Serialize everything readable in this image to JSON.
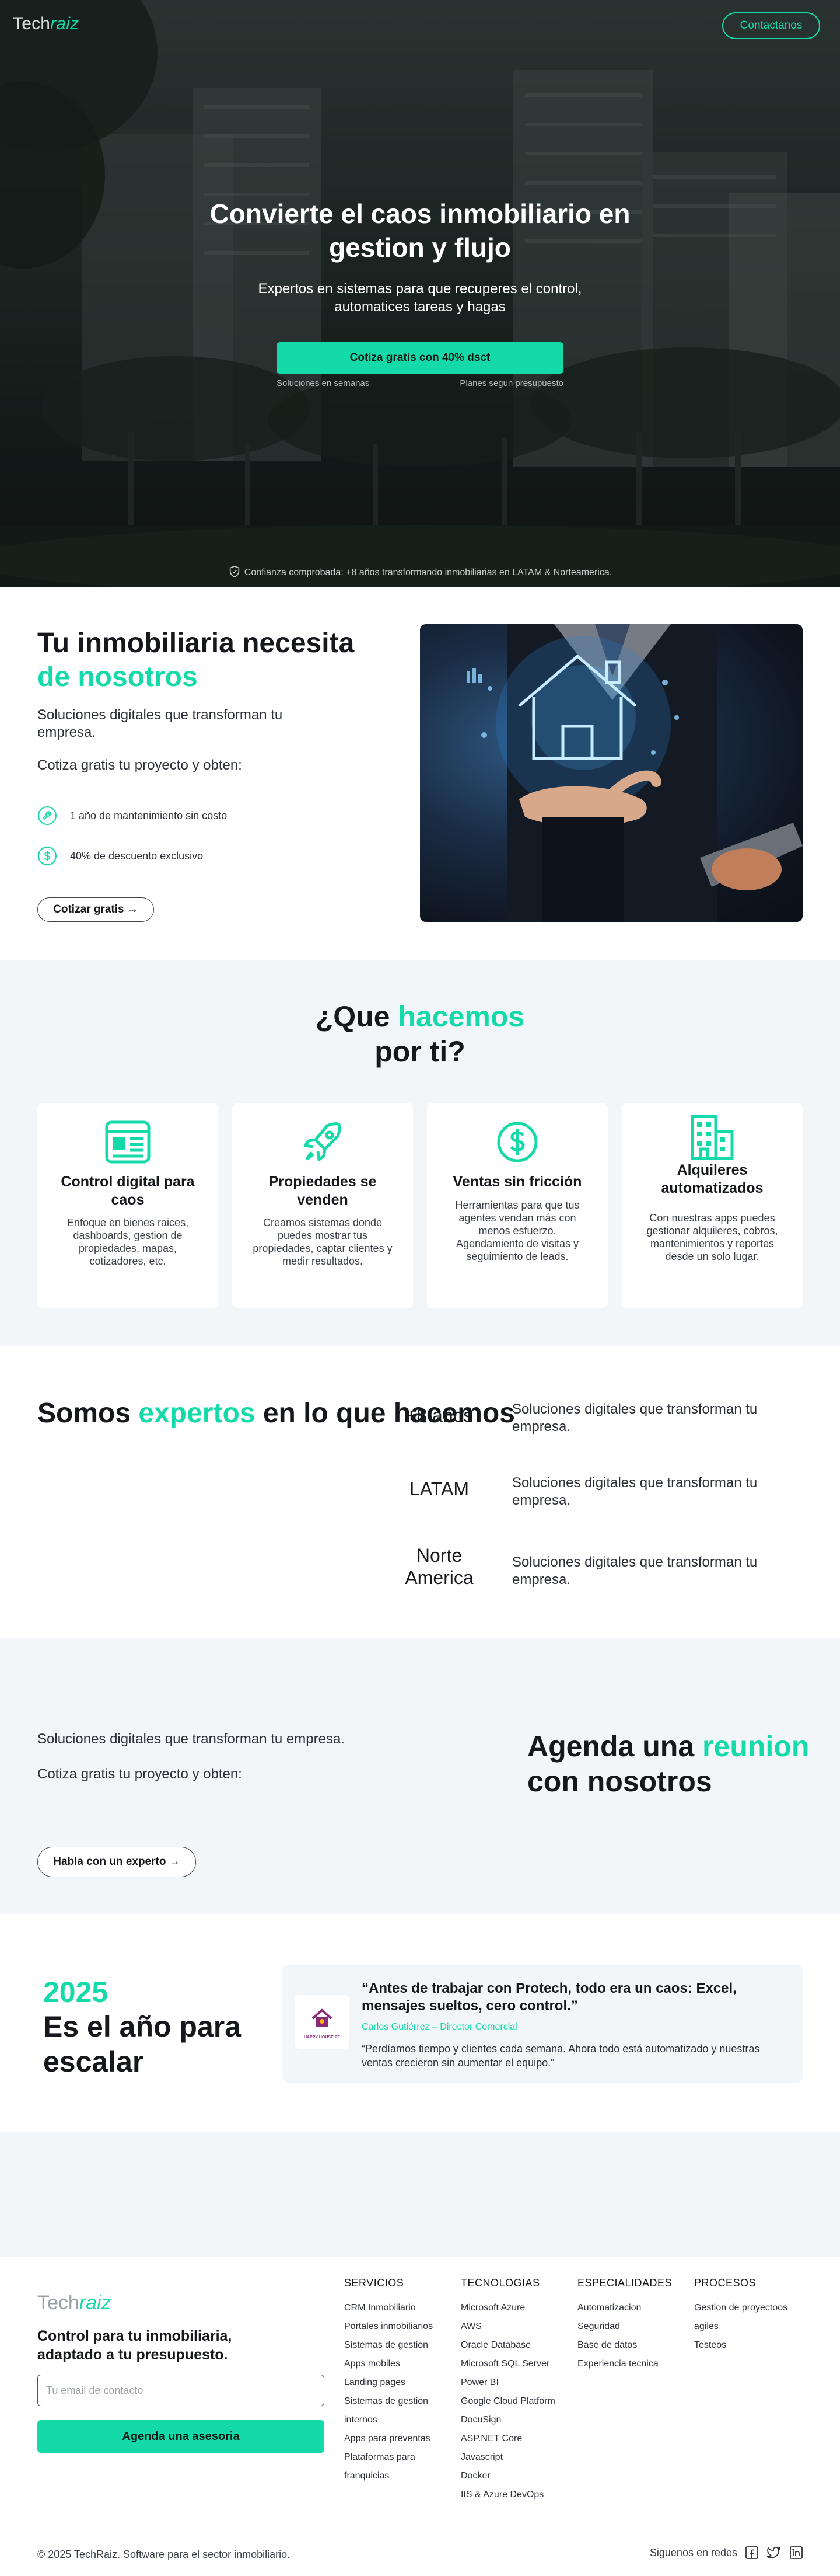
{
  "colors": {
    "accent": "#14d9a8",
    "dark_text": "#16181d",
    "light_section": "#f2f6f9"
  },
  "hero": {
    "logo_main": "Tech",
    "logo_accent": "raiz",
    "contact_button": "Contactanos",
    "title": "Convierte el caos inmobiliario en gestion y flujo",
    "subtitle": "Expertos en sistemas para que recuperes el control, automatices tareas y hagas",
    "cta": "Cotiza gratis con 40% dsct",
    "note_left": "Soluciones en semanas",
    "note_right": "Planes segun presupuesto",
    "trust": "Confianza comprobada: +8 años transformando inmobiliarias en LATAM & Norteamerica.",
    "trust_icon": "shield-check-icon"
  },
  "intro": {
    "title_main": "Tu inmobiliaria necesita",
    "title_accent": "de nosotros",
    "p1": "Soluciones digitales que transforman tu empresa.",
    "p2": "Cotiza gratis tu proyecto y obten:",
    "benefits": [
      {
        "icon": "wrench-icon",
        "text": "1 año de mantenimiento sin costo"
      },
      {
        "icon": "dollar-icon",
        "text": "40% de descuento exclusivo"
      }
    ],
    "button": "Cotizar gratis →",
    "image_icon": "smart-home-hologram-image"
  },
  "services": {
    "title_main": "¿Que",
    "title_accent": "hacemos",
    "title_tail": "por ti?",
    "cards": [
      {
        "icon": "dashboard-icon",
        "title": "Control digital para caos",
        "body": "Enfoque en bienes raices, dashboards, gestion de propiedades, mapas, cotizadores, etc."
      },
      {
        "icon": "rocket-icon",
        "title": "Propiedades se venden",
        "body": "Creamos sistemas donde puedes mostrar tus propiedades, captar clientes y medir resultados."
      },
      {
        "icon": "dollar-circle-icon",
        "title": "Ventas sin fricción",
        "body": "Herramientas para que tus agentes vendan más con menos esfuerzo. Agendamiento de visitas y seguimiento de leads."
      },
      {
        "icon": "building-icon",
        "title": "Alquileres automatizados",
        "body": "Con nuestras apps puedes gestionar alquileres, cobros, mantenimientos y reportes desde un solo lugar."
      }
    ]
  },
  "experts": {
    "title_main": "Somos",
    "title_accent": "expertos",
    "title_tail": "en lo que hacemos",
    "rows": [
      {
        "key": "+8 años",
        "value": "Soluciones digitales que transforman tu empresa."
      },
      {
        "key": "LATAM",
        "value": "Soluciones digitales que transforman tu empresa."
      },
      {
        "key": "Norte America",
        "value": "Soluciones digitales que transforman tu empresa."
      }
    ]
  },
  "meeting": {
    "p1": "Soluciones digitales que transforman tu empresa.",
    "p2": "Cotiza gratis tu proyecto y obten:",
    "button": "Habla con un experto →",
    "title_main": "Agenda una",
    "title_accent": "reunion",
    "title_tail": "con nosotros"
  },
  "testimonial": {
    "year": "2025",
    "title": "Es el año para escalar",
    "logo_text": "HAPPY HOUSE PE",
    "quote": "“Antes de trabajar con Protech, todo era un caos: Excel, mensajes sueltos, cero control.”",
    "author": "Carlos Gutiérrez – Director Comercial",
    "body": "“Perdíamos tiempo y clientes cada semana. Ahora todo está automatizado y nuestras ventas crecieron sin aumentar el equipo.”"
  },
  "footer": {
    "logo_main": "Tech",
    "logo_accent": "raiz",
    "tagline": "Control para tu inmobiliaria, adaptado a tu presupuesto.",
    "email_placeholder": "Tu email de contacto",
    "cta": "Agenda una asesoria",
    "columns": [
      {
        "title": "SERVICIOS",
        "items": [
          "CRM Inmobiliario",
          "Portales inmobiliarios",
          "Sistemas de gestion",
          "Apps mobiles",
          "Landing pages",
          "Sistemas de gestion",
          "internos",
          "Apps para preventas",
          "Plataformas para",
          "franquicias"
        ]
      },
      {
        "title": "TECNOLOGIAS",
        "items": [
          "Microsoft Azure",
          "AWS",
          "Oracle Database",
          "Microsoft SQL Server",
          "Power BI",
          "Google Cloud Platform",
          "DocuSign",
          "ASP.NET Core",
          "Javascript",
          "Docker",
          "IIS & Azure DevOps"
        ]
      },
      {
        "title": "ESPECIALIDADES",
        "items": [
          "Automatizacion",
          "Seguridad",
          "Base de datos",
          "Experiencia tecnica"
        ]
      },
      {
        "title": "PROCESOS",
        "items": [
          "Gestion de proyectoos",
          "agiles",
          "Testeos"
        ]
      }
    ],
    "copyright": "© 2025 TechRaiz. Software para el sector inmobiliario.",
    "social_label": "Siguenos en redes",
    "social_icons": [
      "facebook-icon",
      "twitter-icon",
      "linkedin-icon"
    ]
  }
}
